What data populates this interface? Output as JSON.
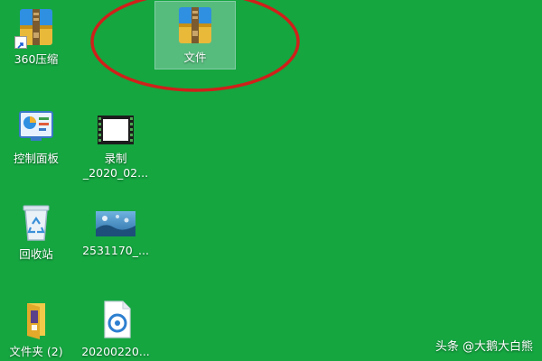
{
  "desktop": {
    "background_color": "#15a640",
    "icons": [
      {
        "label": "360压缩",
        "icon": "winrar-archive-icon"
      },
      {
        "label": "文件",
        "icon": "winrar-archive-icon"
      },
      {
        "label": "控制面板",
        "icon": "control-panel-icon"
      },
      {
        "label": "录制\n_2020_02...",
        "icon": "video-file-icon"
      },
      {
        "label": "回收站",
        "icon": "recycle-bin-icon"
      },
      {
        "label": "2531170_...",
        "icon": "image-file-icon"
      },
      {
        "label": "文件夹 (2)",
        "icon": "folder-icon"
      },
      {
        "label": "20200220...",
        "icon": "media-file-icon"
      }
    ]
  },
  "annotation": {
    "color": "#d0201a"
  },
  "watermark": {
    "text": "头条 @大鹅大白熊"
  }
}
